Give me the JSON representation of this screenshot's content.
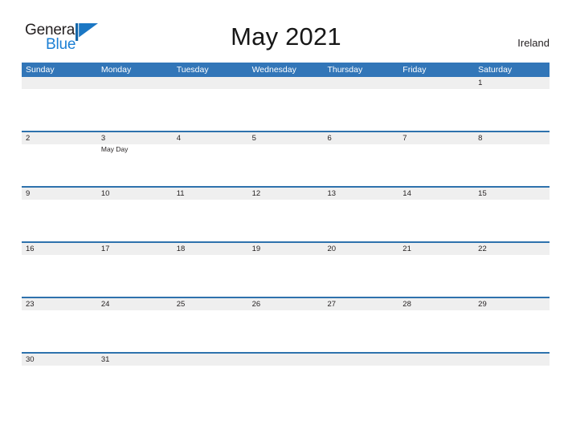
{
  "brand": {
    "name_part1": "General",
    "name_part2": "Blue",
    "mark": "blue-flag-triangle",
    "color_dark": "#231f20",
    "color_blue": "#1b7fd4"
  },
  "header": {
    "title": "May 2021",
    "region": "Ireland"
  },
  "theme": {
    "header_blue": "#3276b8",
    "rule_blue": "#2e72ad",
    "date_band_gray": "#efefef",
    "text": "#231f20"
  },
  "calendar": {
    "month": "May",
    "year": "2021",
    "weekday_headers": [
      "Sunday",
      "Monday",
      "Tuesday",
      "Wednesday",
      "Thursday",
      "Friday",
      "Saturday"
    ],
    "weeks": [
      {
        "days": [
          {
            "date": "",
            "events": []
          },
          {
            "date": "",
            "events": []
          },
          {
            "date": "",
            "events": []
          },
          {
            "date": "",
            "events": []
          },
          {
            "date": "",
            "events": []
          },
          {
            "date": "",
            "events": []
          },
          {
            "date": "1",
            "events": []
          }
        ]
      },
      {
        "days": [
          {
            "date": "2",
            "events": []
          },
          {
            "date": "3",
            "events": [
              "May Day"
            ]
          },
          {
            "date": "4",
            "events": []
          },
          {
            "date": "5",
            "events": []
          },
          {
            "date": "6",
            "events": []
          },
          {
            "date": "7",
            "events": []
          },
          {
            "date": "8",
            "events": []
          }
        ]
      },
      {
        "days": [
          {
            "date": "9",
            "events": []
          },
          {
            "date": "10",
            "events": []
          },
          {
            "date": "11",
            "events": []
          },
          {
            "date": "12",
            "events": []
          },
          {
            "date": "13",
            "events": []
          },
          {
            "date": "14",
            "events": []
          },
          {
            "date": "15",
            "events": []
          }
        ]
      },
      {
        "days": [
          {
            "date": "16",
            "events": []
          },
          {
            "date": "17",
            "events": []
          },
          {
            "date": "18",
            "events": []
          },
          {
            "date": "19",
            "events": []
          },
          {
            "date": "20",
            "events": []
          },
          {
            "date": "21",
            "events": []
          },
          {
            "date": "22",
            "events": []
          }
        ]
      },
      {
        "days": [
          {
            "date": "23",
            "events": []
          },
          {
            "date": "24",
            "events": []
          },
          {
            "date": "25",
            "events": []
          },
          {
            "date": "26",
            "events": []
          },
          {
            "date": "27",
            "events": []
          },
          {
            "date": "28",
            "events": []
          },
          {
            "date": "29",
            "events": []
          }
        ]
      },
      {
        "days": [
          {
            "date": "30",
            "events": []
          },
          {
            "date": "31",
            "events": []
          },
          {
            "date": "",
            "events": []
          },
          {
            "date": "",
            "events": []
          },
          {
            "date": "",
            "events": []
          },
          {
            "date": "",
            "events": []
          },
          {
            "date": "",
            "events": []
          }
        ]
      }
    ]
  }
}
